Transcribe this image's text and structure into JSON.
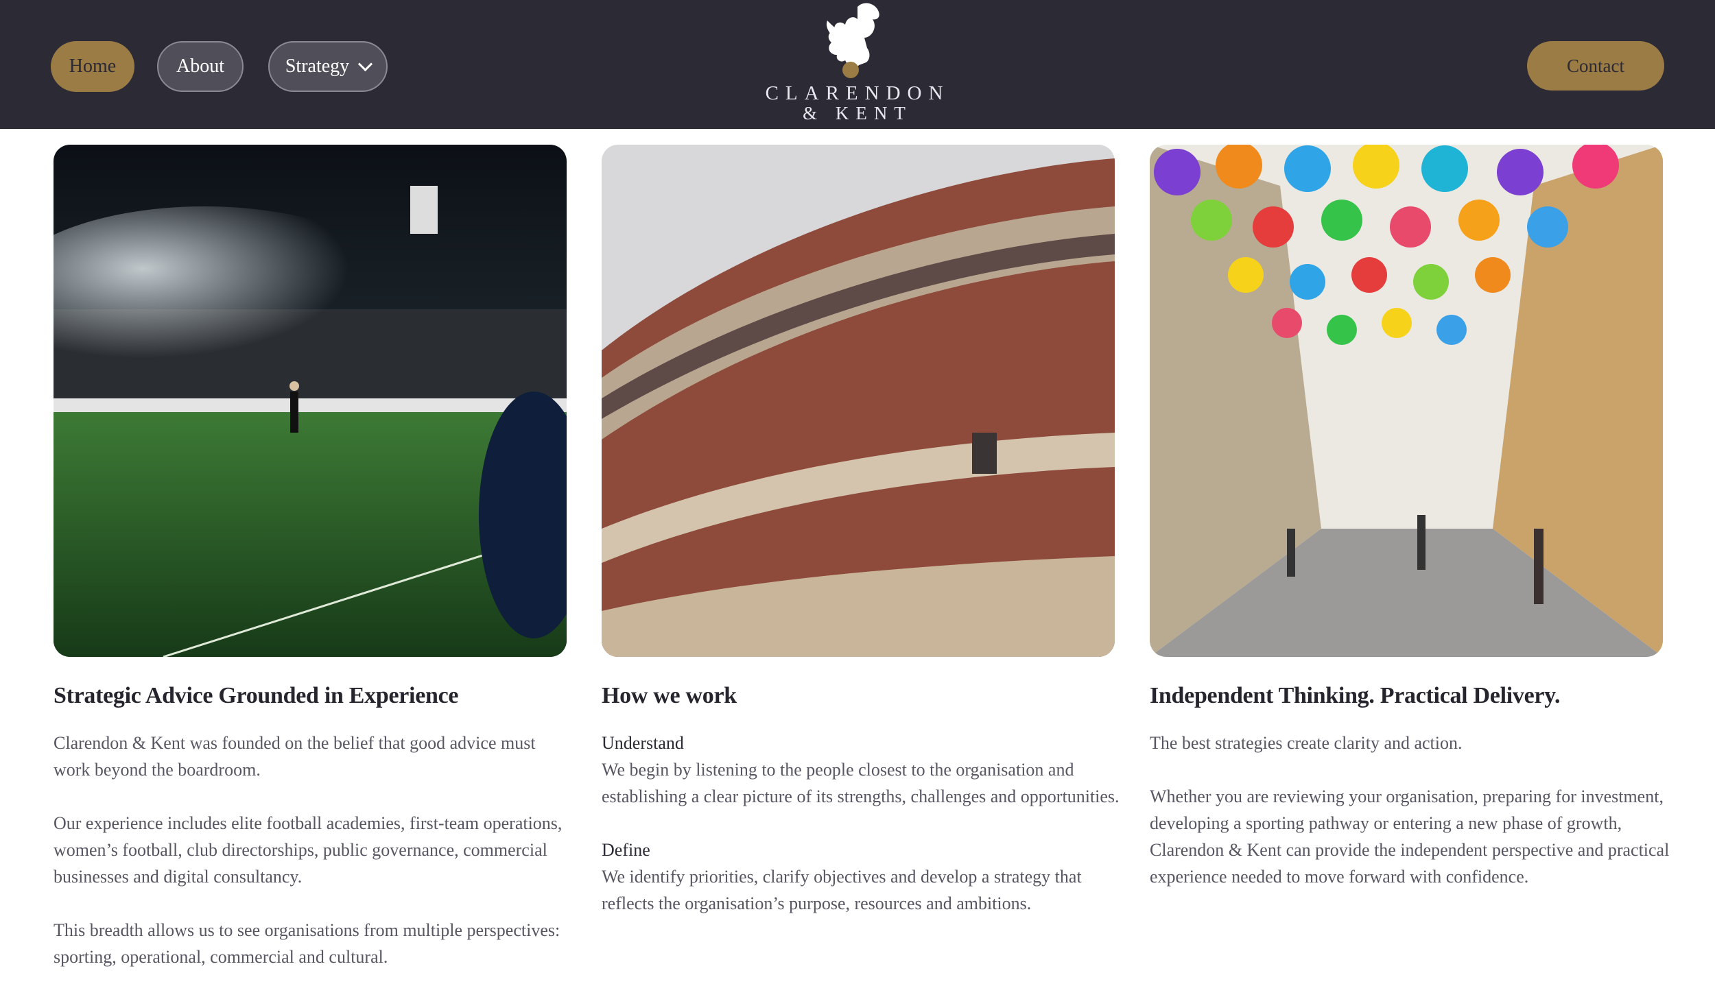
{
  "nav": {
    "home_label": "Home",
    "about_label": "About",
    "strategy_label": "Strategy",
    "contact_label": "Contact"
  },
  "brand": {
    "line1": "CLARENDON",
    "line2": "& KENT",
    "icon": "griffin-icon"
  },
  "colors": {
    "topbar": "#2b2a35",
    "accent_gold": "#9b7c44",
    "pill_grey": "#4f4e59"
  },
  "images": {
    "image1_icon": "football-stadium-image",
    "image2_icon": "royal-albert-hall-image",
    "image3_icon": "umbrella-street-image"
  },
  "col1": {
    "heading": "Strategic Advice Grounded in Experience",
    "p1": "Clarendon & Kent was founded on the belief that good advice must work beyond the boardroom.",
    "p2": "Our experience includes elite football academies, first-team operations, women’s football, club directorships, public governance, commercial businesses and digital consultancy.",
    "p3": "This breadth allows us to see organisations from multiple perspectives: sporting, operational, commercial and cultural."
  },
  "col2": {
    "heading": "How we work",
    "sub1": "Understand",
    "p1": "We begin by listening to the people closest to the organisation and establishing a clear picture of its strengths, challenges and opportunities.",
    "sub2": "Define",
    "p2": "We identify priorities, clarify objectives and develop a strategy that reflects the organisation’s purpose, resources and ambitions."
  },
  "col3": {
    "heading": "Independent Thinking. Practical Delivery.",
    "p1": "The best strategies create clarity and action.",
    "p2": "Whether you are reviewing your organisation, preparing for investment, developing a sporting pathway or entering a new phase of growth, Clarendon & Kent can provide the independent perspective and practical experience needed to move forward with confidence."
  }
}
